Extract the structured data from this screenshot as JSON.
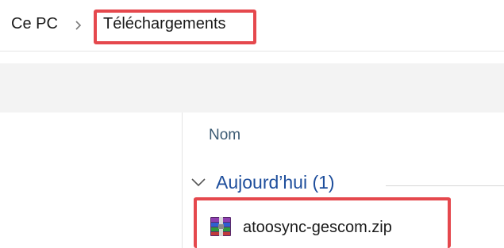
{
  "breadcrumb": {
    "root": "Ce PC",
    "separator_icon": "chevron-right-icon",
    "current": "Téléchargements"
  },
  "file_list": {
    "column_header": "Nom",
    "groups": [
      {
        "label": "Aujourd’hui (1)",
        "expanded": true,
        "files": [
          {
            "name": "atoosync-gescom.zip",
            "icon": "winrar-archive-icon"
          }
        ]
      }
    ]
  },
  "colors": {
    "highlight": "#e5484d",
    "group_label": "#1e4e9c",
    "column_header": "#3b5a73",
    "toolbar": "#f3f3f3"
  }
}
